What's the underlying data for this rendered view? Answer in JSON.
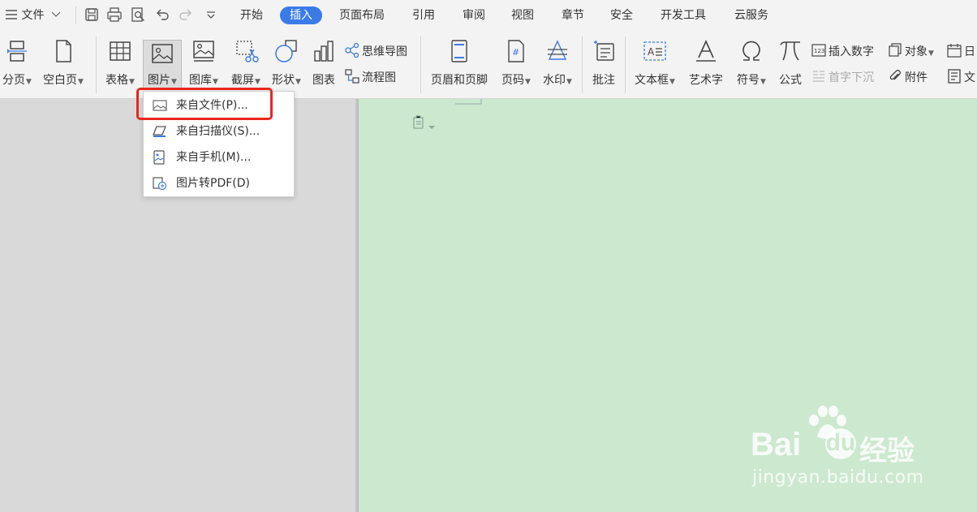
{
  "menubar": {
    "file_label": "文件",
    "tabs": [
      {
        "label": "开始",
        "active": false
      },
      {
        "label": "插入",
        "active": true
      },
      {
        "label": "页面布局",
        "active": false
      },
      {
        "label": "引用",
        "active": false
      },
      {
        "label": "审阅",
        "active": false
      },
      {
        "label": "视图",
        "active": false
      },
      {
        "label": "章节",
        "active": false
      },
      {
        "label": "安全",
        "active": false
      },
      {
        "label": "开发工具",
        "active": false
      },
      {
        "label": "云服务",
        "active": false
      }
    ]
  },
  "ribbon": {
    "page_break": "分页",
    "blank_page": "空白页",
    "table": "表格",
    "picture": "图片",
    "gallery": "图库",
    "screenshot": "截屏",
    "shapes": "形状",
    "chart": "图表",
    "mindmap": "思维导图",
    "flowchart": "流程图",
    "header_footer": "页眉和页脚",
    "page_number": "页码",
    "watermark": "水印",
    "comment": "批注",
    "textbox": "文本框",
    "wordart": "艺术字",
    "symbol": "符号",
    "equation": "公式",
    "insert_number": "插入数字",
    "drop_cap": "首字下沉",
    "object": "对象",
    "attachment": "附件",
    "date_partial": "日",
    "text_partial": "文"
  },
  "picture_menu": {
    "items": [
      {
        "label": "来自文件(P)...",
        "icon": "image-file-icon"
      },
      {
        "label": "来自扫描仪(S)...",
        "icon": "scanner-icon"
      },
      {
        "label": "来自手机(M)...",
        "icon": "phone-image-icon"
      },
      {
        "label": "图片转PDF(D)",
        "icon": "image-to-pdf-icon"
      }
    ]
  },
  "watermark": {
    "brand_text": "Bai",
    "brand_text2": "经验",
    "url": "jingyan.baidu.com"
  },
  "colors": {
    "accent": "#3b7be8",
    "highlight": "#e8271f",
    "page_bg": "#cce8cf"
  }
}
